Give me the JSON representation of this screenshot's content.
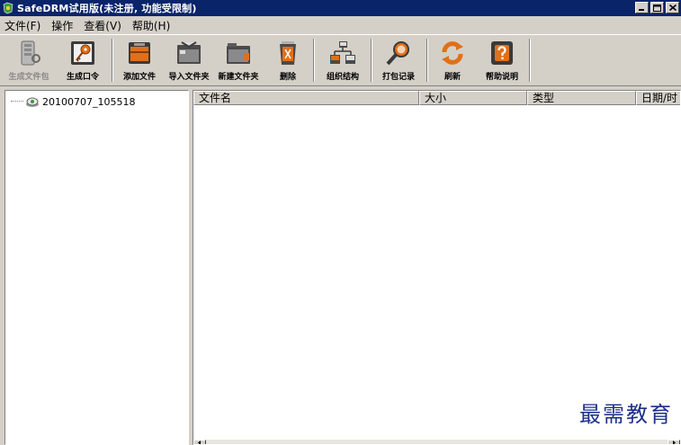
{
  "window": {
    "title": "SafeDRM试用版(未注册, 功能受限制)"
  },
  "menu": [
    "文件(F)",
    "操作",
    "查看(V)",
    "帮助(H)"
  ],
  "toolbar": {
    "buttons": [
      {
        "label": "生成文件包",
        "icon": "package-icon",
        "disabled": true
      },
      {
        "label": "生成口令",
        "icon": "key-icon",
        "disabled": false
      },
      {
        "label": "添加文件",
        "icon": "add-file-icon",
        "disabled": false
      },
      {
        "label": "导入文件夹",
        "icon": "import-folder-icon",
        "disabled": false
      },
      {
        "label": "新建文件夹",
        "icon": "new-folder-icon",
        "disabled": false
      },
      {
        "label": "删除",
        "icon": "delete-icon",
        "disabled": false
      },
      {
        "label": "组织结构",
        "icon": "org-structure-icon",
        "disabled": false
      },
      {
        "label": "打包记录",
        "icon": "search-record-icon",
        "disabled": false
      },
      {
        "label": "刷新",
        "icon": "refresh-icon",
        "disabled": false
      },
      {
        "label": "帮助说明",
        "icon": "help-icon",
        "disabled": false
      }
    ]
  },
  "tree": {
    "root": "20100707_105518"
  },
  "list": {
    "columns": [
      "文件名",
      "大小",
      "类型",
      "日期/时"
    ]
  },
  "watermark": "最需教育",
  "colors": {
    "titlebar": "#0a246a",
    "face": "#d4d0c8",
    "accent_orange": "#e0701a",
    "watermark": "#1e2f8a"
  }
}
